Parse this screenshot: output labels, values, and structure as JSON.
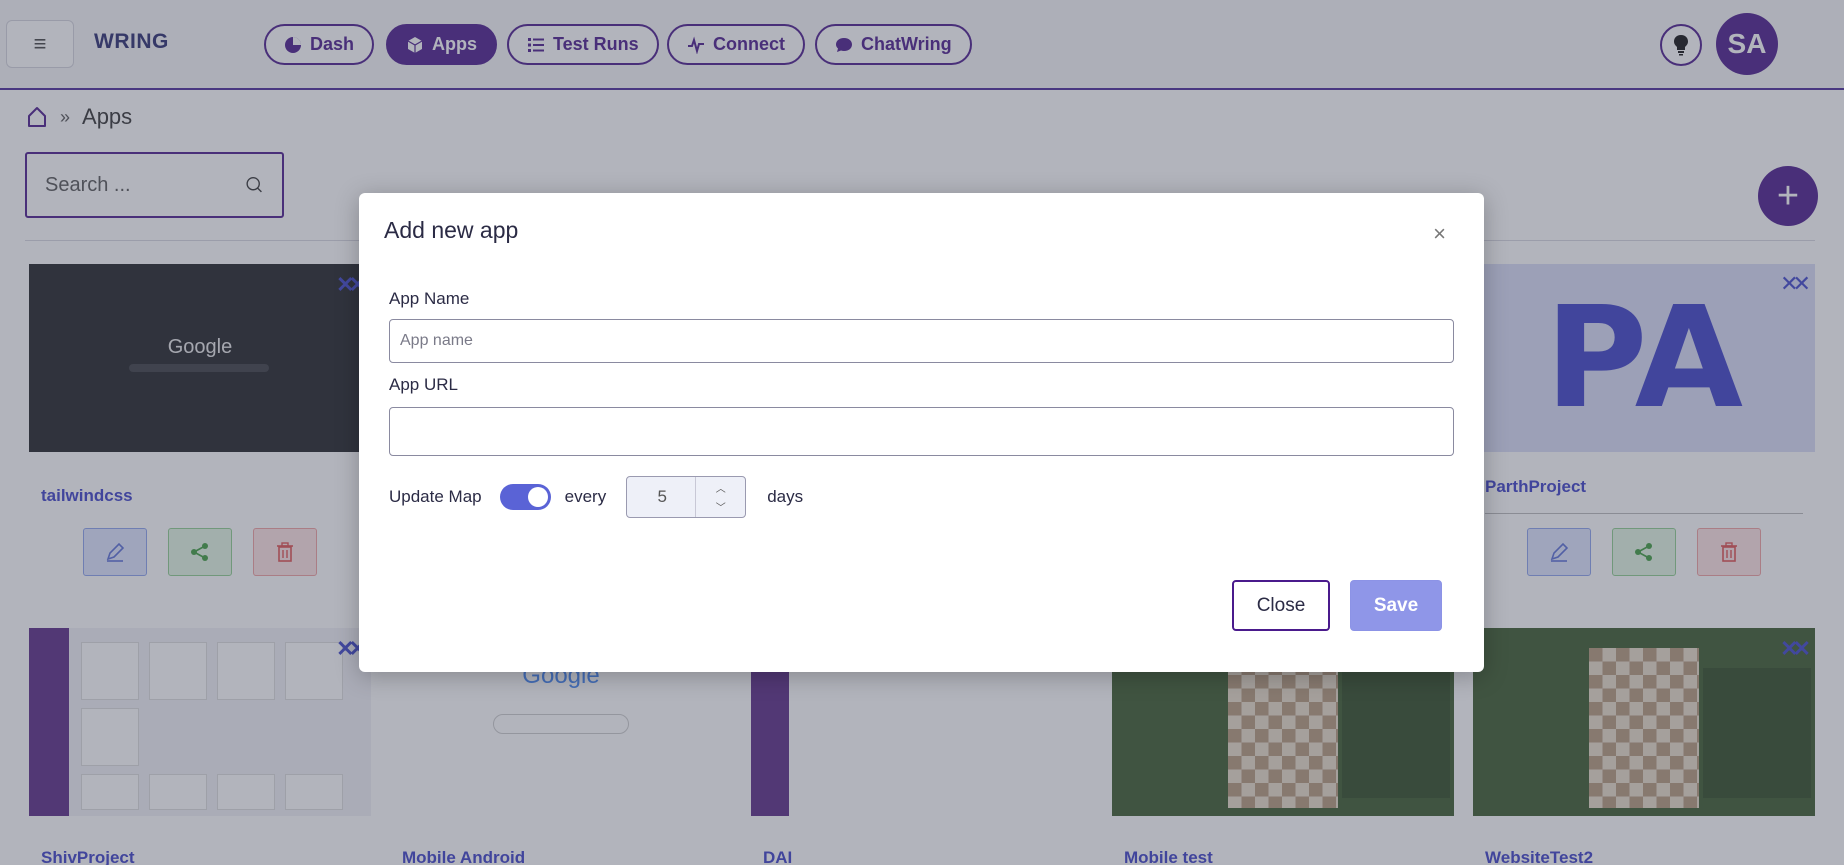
{
  "app": {
    "brand": "WRING"
  },
  "nav": {
    "menu_icon": "hamburger-icon",
    "items": [
      {
        "label": "Dash",
        "icon": "pie-chart-icon",
        "active": false
      },
      {
        "label": "Apps",
        "icon": "cube-icon",
        "active": true
      },
      {
        "label": "Test Runs",
        "icon": "list-icon",
        "active": false
      },
      {
        "label": "Connect",
        "icon": "pulse-icon",
        "active": false
      },
      {
        "label": "ChatWring",
        "icon": "chat-icon",
        "active": false
      }
    ],
    "avatar_initials": "SA",
    "theme_icon": "lightbulb-icon"
  },
  "breadcrumb": {
    "current": "Apps"
  },
  "search": {
    "placeholder": "Search ..."
  },
  "cards": [
    {
      "title": "tailwindcss",
      "thumb": "google-dark"
    },
    {
      "title": "ParthProject",
      "thumb": "initials",
      "initials": "PA"
    },
    {
      "title": "ShivProject",
      "thumb": "admin"
    },
    {
      "title": "Mobile Android",
      "thumb": "google-light"
    },
    {
      "title": "DAI",
      "thumb": "sidebar"
    },
    {
      "title": "Mobile test",
      "thumb": "chess"
    },
    {
      "title": "WebsiteTest2",
      "thumb": "chess"
    }
  ],
  "modal": {
    "title": "Add new app",
    "close_symbol": "×",
    "app_name_label": "App Name",
    "app_name_placeholder": "App name",
    "app_name_value": "",
    "app_url_label": "App URL",
    "app_url_value": "",
    "update_map_label": "Update Map",
    "update_map_enabled": true,
    "every_label": "every",
    "interval_value": "5",
    "days_label": "days",
    "close_button": "Close",
    "save_button": "Save"
  },
  "colors": {
    "primary": "#4a1a8c",
    "accent": "#3d40c8",
    "save_disabled": "#8f96e8"
  }
}
